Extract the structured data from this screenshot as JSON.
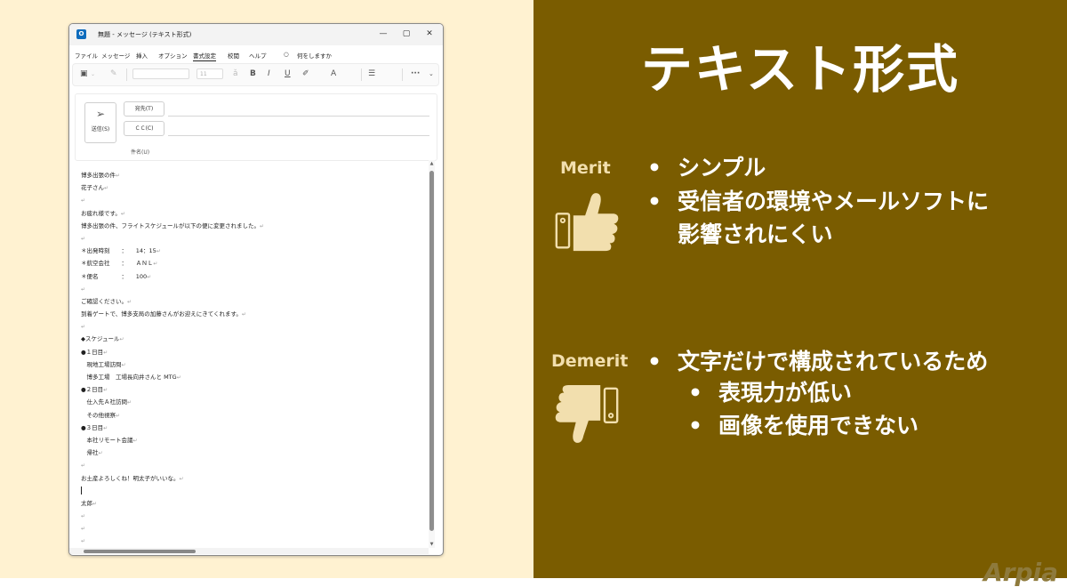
{
  "window": {
    "title": "無題 - メッセージ (テキスト形式)",
    "controls": {
      "minimize": "—",
      "maximize": "▢",
      "close": "✕"
    }
  },
  "menu": [
    "ファイル",
    "メッセージ",
    "挿入",
    "オプション",
    "書式設定",
    "校閲",
    "ヘルプ"
  ],
  "menu_active": "書式設定",
  "tell_me": "何をしますか",
  "ribbon": {
    "font_size": "11",
    "bold": "B",
    "italic": "I",
    "underline": "U",
    "more": "···"
  },
  "compose": {
    "send_label": "送信(S)",
    "to_label": "宛先(T)",
    "cc_label": "ＣＣ(C)",
    "subject_label": "件名(U)"
  },
  "body_lines": [
    "博多出張の件",
    "花子さん",
    "",
    "お疲れ様です。",
    "博多出張の件、フライトスケジュールが以下の便に変更されました。",
    "",
    "＊出発時刻　　：　　14：15",
    "＊航空会社　　：　　ＡＮＬ",
    "＊便名　　　　：　　100",
    "",
    "ご確認ください。",
    "到着ゲートで、博多支局の加藤さんがお迎えにきてくれます。",
    "",
    "◆スケジュール",
    "●１日目",
    "　現地工場訪問",
    "　博多工場　工場長向井さんと MTG",
    "●２日目",
    "　仕入先Ａ社訪問",
    "　その他視察",
    "●３日目",
    "　本社リモート会議",
    "　帰社",
    "",
    "お土産よろしくね！明太子がいいな。",
    "",
    "太郎",
    "",
    "",
    ""
  ],
  "paragraph_mark": "↵",
  "slide": {
    "title": "テキスト形式",
    "merit_label": "Merit",
    "merit_items": [
      "シンプル",
      "受信者の環境やメールソフトに",
      "影響されにくい"
    ],
    "demerit_label": "Demerit",
    "demerit_items": [
      "文字だけで構成されているため"
    ],
    "demerit_sub_items": [
      "表現力が低い",
      "画像を使用できない"
    ],
    "bullet_char": "•",
    "watermark": "Arpia"
  },
  "colors": {
    "left_bg": "#fff2d1",
    "right_bg": "#7a5c00",
    "label": "#f2dfae",
    "icon": "#f2dfae"
  }
}
